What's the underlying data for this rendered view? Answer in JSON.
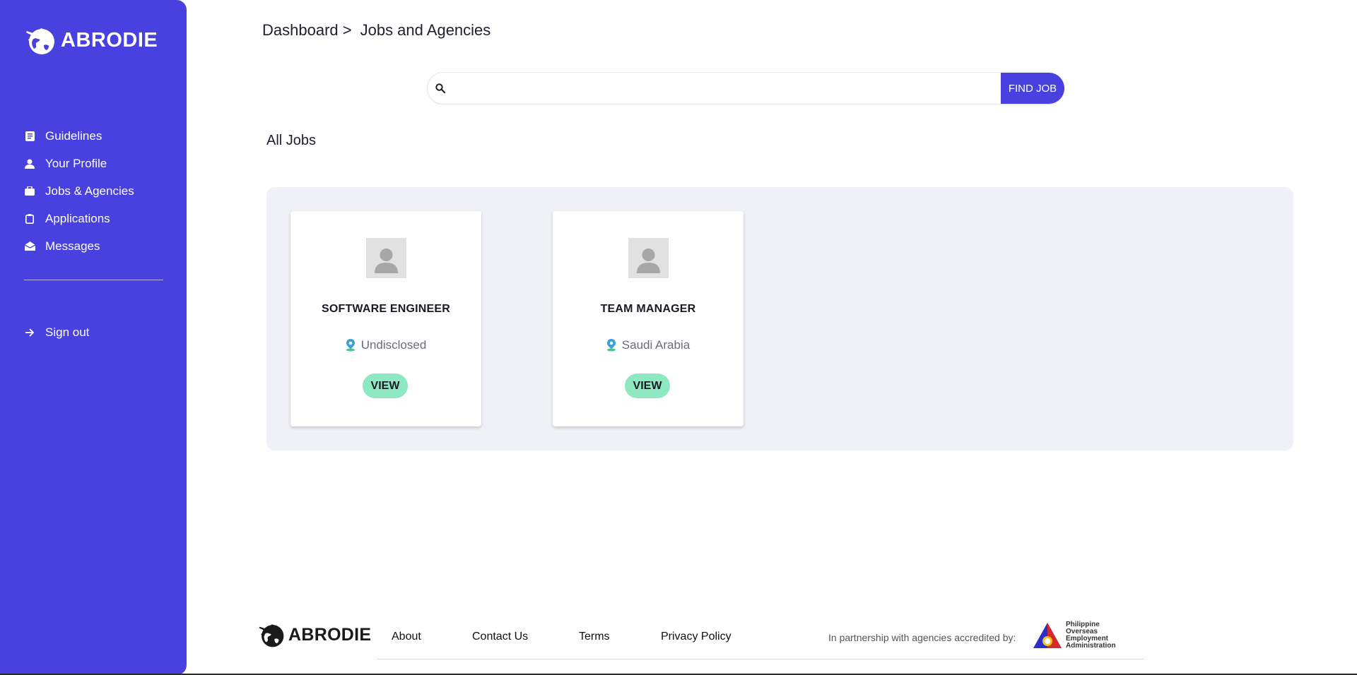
{
  "brand": {
    "name": "ABRODIE"
  },
  "sidebar": {
    "items": [
      {
        "label": "Guidelines",
        "icon": "document-icon"
      },
      {
        "label": "Your Profile",
        "icon": "person-icon"
      },
      {
        "label": "Jobs & Agencies",
        "icon": "briefcase-icon"
      },
      {
        "label": "Applications",
        "icon": "clipboard-icon"
      },
      {
        "label": "Messages",
        "icon": "envelope-open-icon"
      }
    ],
    "signout": {
      "label": "Sign out",
      "icon": "arrow-right-icon"
    }
  },
  "breadcrumb": {
    "root": "Dashboard >",
    "current": "Jobs and Agencies"
  },
  "search": {
    "value": "",
    "placeholder": "",
    "button_label": "FIND JOB"
  },
  "section": {
    "title": "All Jobs"
  },
  "jobs": [
    {
      "title": "SOFTWARE ENGINEER",
      "location": "Undisclosed",
      "action": "VIEW"
    },
    {
      "title": "TEAM MANAGER",
      "location": "Saudi Arabia",
      "action": "VIEW"
    }
  ],
  "footer": {
    "brand": "ABRODIE",
    "links": [
      "About",
      "Contact Us",
      "Terms",
      "Privacy Policy"
    ],
    "partner_text": "In partnership with agencies accredited by:",
    "poea_lines": [
      "Philippine",
      "Overseas",
      "Employment",
      "Administration"
    ]
  },
  "colors": {
    "primary": "#4840df",
    "accent": "#8ee9c2",
    "panel": "#f0f1f6"
  }
}
